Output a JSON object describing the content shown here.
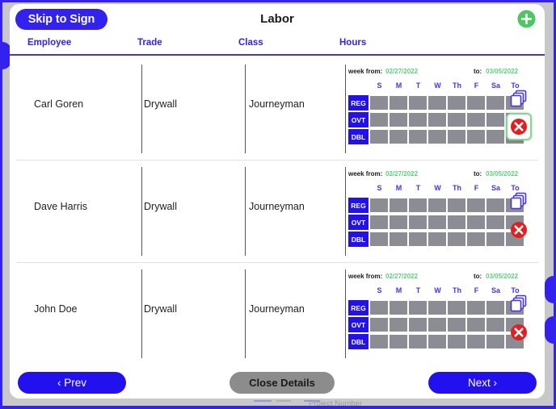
{
  "header": {
    "skip_label": "Skip to Sign",
    "title": "Labor",
    "add_icon": "plus-circle-icon"
  },
  "columns": {
    "employee": "Employee",
    "trade": "Trade",
    "class": "Class",
    "hours": "Hours"
  },
  "timesheet_common": {
    "week_from_label": "week from:",
    "week_to_label": "to:",
    "day_headers": [
      "S",
      "M",
      "T",
      "W",
      "Th",
      "F",
      "Sa",
      "To"
    ],
    "row_labels": [
      "REG",
      "OVT",
      "DBL"
    ],
    "cells_per_row": 8,
    "copy_icon": "copy-icon",
    "delete_icon": "delete-circle-icon"
  },
  "rows": [
    {
      "employee": "Carl Goren",
      "trade": "Drywall",
      "class": "Journeyman",
      "week_from": "02/27/2022",
      "week_to": "03/05/2022",
      "delete_focused": true
    },
    {
      "employee": "Dave Harris",
      "trade": "Drywall",
      "class": "Journeyman",
      "week_from": "02/27/2022",
      "week_to": "03/05/2022",
      "delete_focused": false
    },
    {
      "employee": "John Doe",
      "trade": "Drywall",
      "class": "Journeyman",
      "week_from": "02/27/2022",
      "week_to": "03/05/2022",
      "delete_focused": false
    }
  ],
  "ghost_overlay": {
    "label": "Project Number"
  },
  "footer": {
    "prev_label": "‹ Prev",
    "close_details_label": "Close Details",
    "next_label": "Next ›"
  },
  "colors": {
    "primary_blue": "#3322ee",
    "grid_blue": "#2211ee",
    "accent_green": "#5ccf7f",
    "add_green": "#4cc764",
    "delete_red": "#e02020",
    "cell_gray": "#8c8c94",
    "footer_gray": "#8c8c8c",
    "focus_ring_green": "#7ed992"
  }
}
